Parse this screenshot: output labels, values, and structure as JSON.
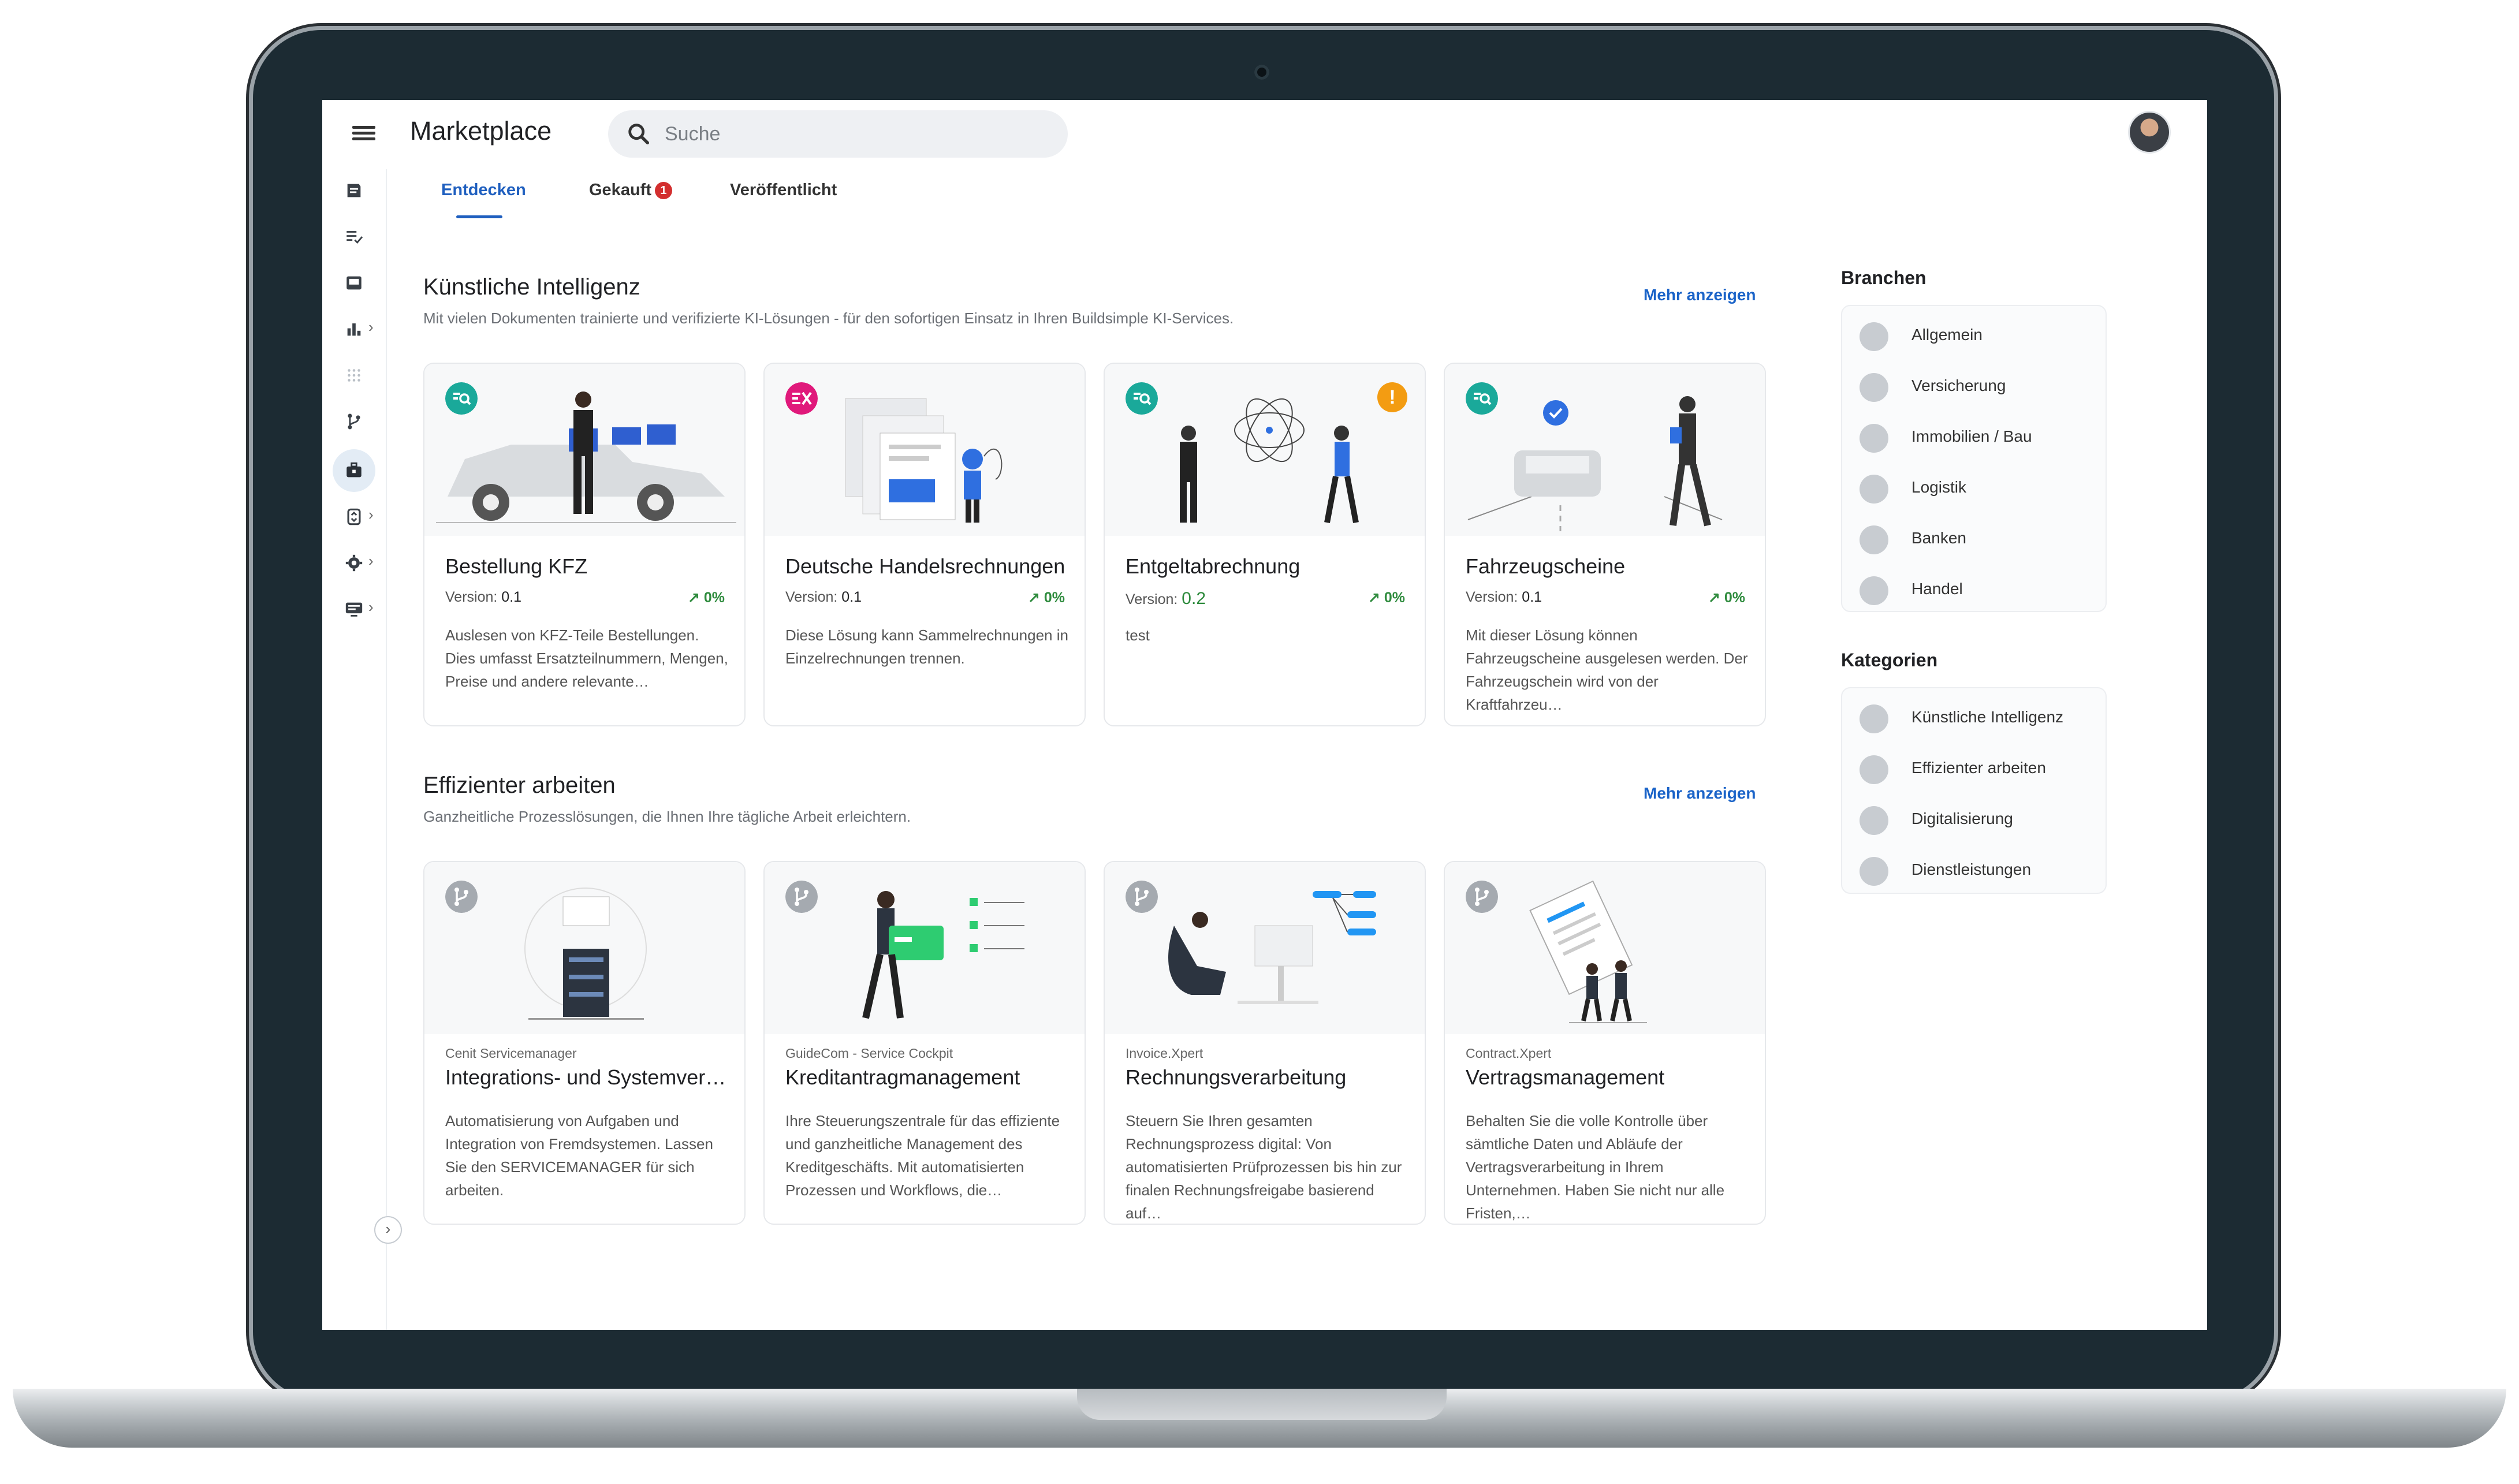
{
  "app": {
    "title": "Marketplace"
  },
  "search": {
    "placeholder": "Suche"
  },
  "tabs": [
    {
      "label": "Entdecken",
      "active": true
    },
    {
      "label": "Gekauft",
      "badge": "1"
    },
    {
      "label": "Veröffentlicht"
    }
  ],
  "sections": [
    {
      "title": "Künstliche Intelligenz",
      "subtitle": "Mit vielen Dokumenten trainierte und verifizierte KI-Lösungen - für den sofortigen Einsatz in Ihren Buildsimple KI-Services.",
      "more": "Mehr anzeigen",
      "cards": [
        {
          "title": "Bestellung KFZ",
          "version_label": "Version:",
          "version": "0.1",
          "trend": "0%",
          "description": "Auslesen von KFZ-Teile Bestellungen. Dies umfasst Ersatzteilnummern, Mengen, Preise und andere relevante…",
          "icon": "document-search-icon",
          "icon_color": "#1aa99a"
        },
        {
          "title": "Deutsche Handelsrechnungen",
          "version_label": "Version:",
          "version": "0.1",
          "trend": "0%",
          "description": "Diese Lösung kann Sammelrechnungen in Einzelrechnungen trennen.",
          "icon": "document-split-icon",
          "icon_color": "#e0197b"
        },
        {
          "title": "Entgeltabrechnung",
          "version_label": "Version:",
          "version": "0.2",
          "trend": "0%",
          "description": "test",
          "icon": "document-search-icon",
          "icon_color": "#1aa99a",
          "warning": "!"
        },
        {
          "title": "Fahrzeugscheine",
          "version_label": "Version:",
          "version": "0.1",
          "trend": "0%",
          "description": "Mit dieser Lösung können Fahrzeugscheine ausgelesen werden. Der Fahrzeugschein wird von der Kraftfahrzeu…",
          "icon": "document-search-icon",
          "icon_color": "#1aa99a"
        }
      ]
    },
    {
      "title": "Effizienter arbeiten",
      "subtitle": "Ganzheitliche Prozesslösungen, die Ihnen Ihre tägliche Arbeit erleichtern.",
      "more": "Mehr anzeigen",
      "cards": [
        {
          "maker": "Cenit Servicemanager",
          "title": "Integrations- und Systemverw…",
          "description": "Automatisierung von Aufgaben und Integration von Fremdsystemen. Lassen Sie den SERVICEMANAGER für sich arbeiten.",
          "icon": "workflow-icon"
        },
        {
          "maker": "GuideCom - Service Cockpit",
          "title": "Kreditantragmanagement",
          "description": "Ihre Steuerungszentrale für das effiziente und ganzheitliche Management des Kreditgeschäfts. Mit automatisierten Prozessen und Workflows, die…",
          "icon": "workflow-icon"
        },
        {
          "maker": "Invoice.Xpert",
          "title": "Rechnungsverarbeitung",
          "description": "Steuern Sie Ihren gesamten Rechnungsprozess digital: Von automatisierten Prüfprozessen bis hin zur finalen Rechnungsfreigabe basierend auf…",
          "icon": "workflow-icon"
        },
        {
          "maker": "Contract.Xpert",
          "title": "Vertragsmanagement",
          "description": "Behalten Sie die volle Kontrolle über sämtliche Daten und Abläufe der Vertragsverarbeitung in Ihrem Unternehmen. Haben Sie nicht nur alle Fristen,…",
          "icon": "workflow-icon"
        }
      ]
    }
  ],
  "branchen": {
    "title": "Branchen",
    "items": [
      {
        "label": "Allgemein",
        "icon": "puzzle-icon"
      },
      {
        "label": "Versicherung",
        "icon": "shield-icon"
      },
      {
        "label": "Immobilien / Bau",
        "icon": "wrench-icon"
      },
      {
        "label": "Logistik",
        "icon": "truck-icon"
      },
      {
        "label": "Banken",
        "icon": "bank-icon"
      },
      {
        "label": "Handel",
        "icon": "basket-icon"
      }
    ]
  },
  "kategorien": {
    "title": "Kategorien",
    "items": [
      {
        "label": "Künstliche Intelligenz",
        "icon": "bulb-icon"
      },
      {
        "label": "Effizienter arbeiten",
        "icon": "workflow-icon"
      },
      {
        "label": "Digitalisierung",
        "icon": "cloud-icon"
      },
      {
        "label": "Dienstleistungen",
        "icon": "toolbox-icon"
      }
    ]
  },
  "colors": {
    "accent": "#1f5fbf",
    "link": "#1a63c8",
    "trend": "#2e8b3d",
    "bezel": "#1c2b33"
  }
}
